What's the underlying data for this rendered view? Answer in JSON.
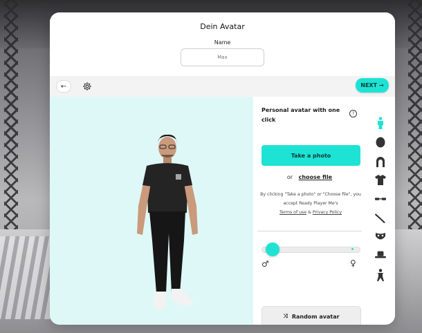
{
  "header": {
    "title": "Dein Avatar",
    "name_label": "Name",
    "name_placeholder": "Max"
  },
  "toolbar": {
    "back_icon": "arrow-left-icon",
    "settings_icon": "gear-icon",
    "next_label": "NEXT",
    "next_icon": "arrow-right-icon"
  },
  "panel": {
    "title": "Personal avatar with one click",
    "photo_button": "Take a photo",
    "or_text": "or",
    "choose_file": "choose file",
    "consent_prefix": "By clicking \"Take a photo\" or \"Choose file\", you accept Ready Player Me's",
    "terms": "Terms of use",
    "amp": "&",
    "privacy": "Privacy Policy",
    "gender_slider": 0.05,
    "male_symbol": "♂",
    "female_symbol": "♀",
    "random_button": "Random avatar"
  },
  "rail": {
    "items": [
      "body-icon",
      "head-icon",
      "hair-icon",
      "shirt-icon",
      "glasses-icon",
      "eyebrow-icon",
      "mask-icon",
      "hat-icon",
      "figure-icon"
    ]
  },
  "colors": {
    "accent": "#1ee3d4",
    "preview_bg": "#def8f7"
  }
}
